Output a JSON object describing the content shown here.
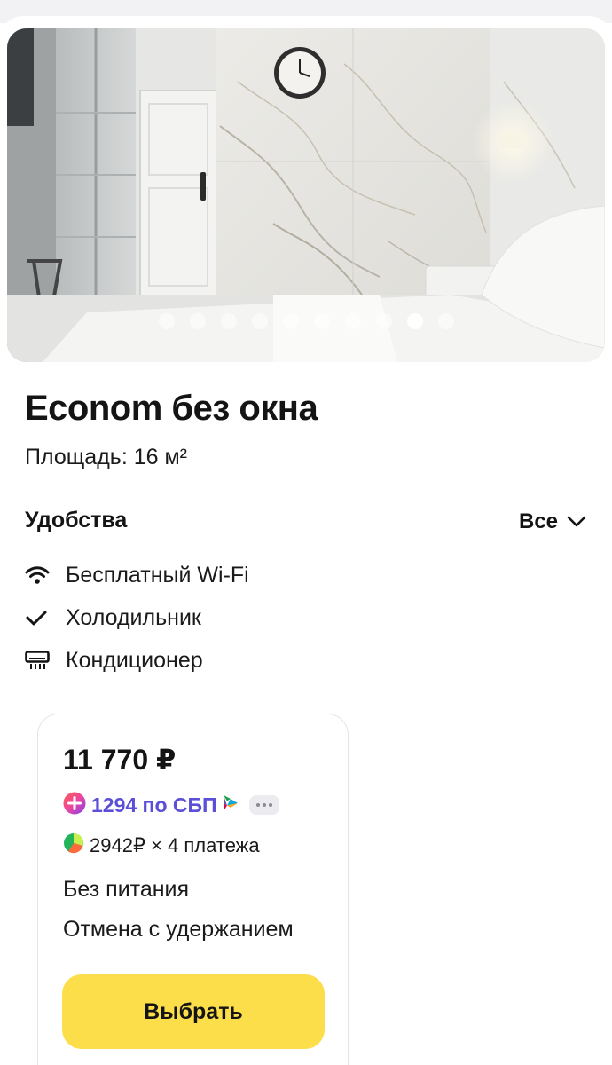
{
  "room": {
    "title": "Econom без окна",
    "area": "Площадь: 16 м²"
  },
  "gallery": {
    "dot_count": 10,
    "active_index": 8,
    "clock_icon": "wall-clock"
  },
  "amenities": {
    "heading": "Удобства",
    "all_label": "Все",
    "items": [
      {
        "icon": "wifi-icon",
        "label": "Бесплатный Wi-Fi"
      },
      {
        "icon": "check-icon",
        "label": "Холодильник"
      },
      {
        "icon": "air-conditioner-icon",
        "label": "Кондиционер"
      }
    ]
  },
  "offer": {
    "price": "11 770 ₽",
    "sbp_text": "1294 по СБП",
    "split_text": "2942₽ × 4 платежа",
    "meal": "Без питания",
    "cancellation": "Отмена с удержанием",
    "select_label": "Выбрать"
  },
  "colors": {
    "accent_yellow": "#fcdd4a",
    "sbp_purple": "#5b4fd8",
    "text": "#141414"
  }
}
